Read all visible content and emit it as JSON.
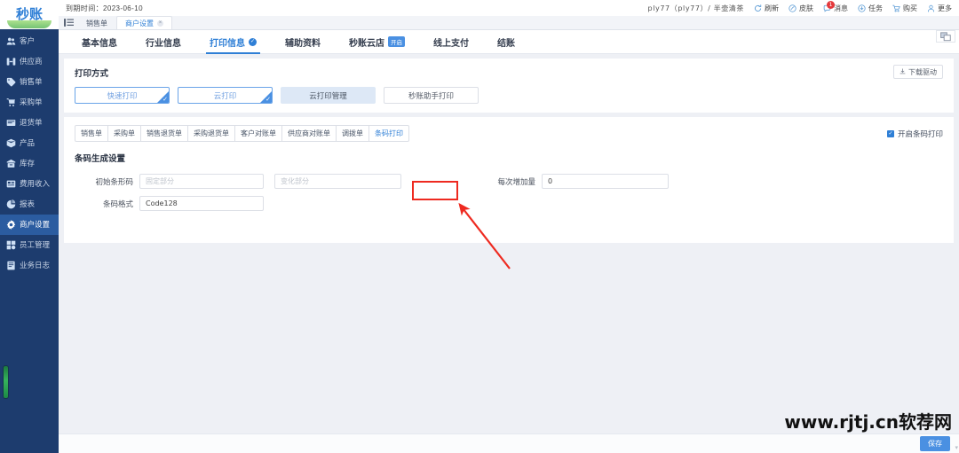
{
  "brand": {
    "logo_text": "秒账"
  },
  "sidebar": {
    "items": [
      {
        "label": "客户",
        "icon": "users-icon"
      },
      {
        "label": "供应商",
        "icon": "supplier-icon"
      },
      {
        "label": "销售单",
        "icon": "sales-order-icon"
      },
      {
        "label": "采购单",
        "icon": "cart-icon"
      },
      {
        "label": "退货单",
        "icon": "return-icon"
      },
      {
        "label": "产品",
        "icon": "box-icon"
      },
      {
        "label": "库存",
        "icon": "warehouse-icon"
      },
      {
        "label": "费用收入",
        "icon": "expense-icon"
      },
      {
        "label": "报表",
        "icon": "chart-icon"
      },
      {
        "label": "商户设置",
        "icon": "gear-icon"
      },
      {
        "label": "员工管理",
        "icon": "staff-icon"
      },
      {
        "label": "业务日志",
        "icon": "log-icon"
      }
    ],
    "active_index": 9
  },
  "topbar": {
    "expire_label": "到期时间：2023-06-10",
    "user": "ply77（ply77）/ 半壶清茶",
    "actions": [
      {
        "label": "刷新",
        "icon": "refresh-icon",
        "badge": ""
      },
      {
        "label": "皮肤",
        "icon": "skin-icon",
        "badge": ""
      },
      {
        "label": "消息",
        "icon": "message-icon",
        "badge": "1"
      },
      {
        "label": "任务",
        "icon": "task-icon",
        "badge": ""
      },
      {
        "label": "购买",
        "icon": "cart-icon",
        "badge": ""
      },
      {
        "label": "更多",
        "icon": "user-more-icon",
        "badge": ""
      }
    ]
  },
  "window_tabs": {
    "items": [
      {
        "label": "销售单",
        "closable": false,
        "active": false
      },
      {
        "label": "商户设置",
        "closable": true,
        "active": true
      }
    ],
    "close_glyph": "×"
  },
  "module_tabs": [
    {
      "label": "基本信息",
      "active": false,
      "badge": ""
    },
    {
      "label": "行业信息",
      "active": false,
      "badge": ""
    },
    {
      "label": "打印信息",
      "active": true,
      "badge": ""
    },
    {
      "label": "辅助资料",
      "active": false,
      "badge": ""
    },
    {
      "label": "秒账云店",
      "active": false,
      "badge": "开启"
    },
    {
      "label": "线上支付",
      "active": false,
      "badge": ""
    },
    {
      "label": "结账",
      "active": false,
      "badge": ""
    }
  ],
  "print_section": {
    "title": "打印方式",
    "download_label": "下载驱动",
    "buttons": [
      {
        "label": "快速打印",
        "state": "selected"
      },
      {
        "label": "云打印",
        "state": "selected"
      },
      {
        "label": "云打印管理",
        "state": "filled"
      },
      {
        "label": "秒账助手打印",
        "state": "normal"
      }
    ]
  },
  "doc_tabs": {
    "items": [
      {
        "label": "销售单",
        "active": false
      },
      {
        "label": "采购单",
        "active": false
      },
      {
        "label": "销售退货单",
        "active": false
      },
      {
        "label": "采购退货单",
        "active": false
      },
      {
        "label": "客户对账单",
        "active": false
      },
      {
        "label": "供应商对账单",
        "active": false
      },
      {
        "label": "调拨单",
        "active": false
      },
      {
        "label": "条码打印",
        "active": true
      }
    ],
    "checkbox": {
      "label": "开启条码打印",
      "checked": true,
      "glyph": "✓"
    }
  },
  "barcode_form": {
    "title": "条码生成设置",
    "fields": {
      "initial_label": "初始条形码",
      "fixed_placeholder": "固定部分",
      "variable_placeholder": "变化部分",
      "format_label": "条码格式",
      "format_value": "Code128",
      "increment_label": "每次增加量",
      "increment_value": "0"
    }
  },
  "footer": {
    "save_label": "保存"
  },
  "watermark": {
    "text": "www.rjtj.cn软荐网"
  },
  "colors": {
    "sidebar": "#1d3c6e",
    "sidebar_active": "#2b5ca0",
    "accent": "#2f7fd6",
    "button_blue": "#4a90e2",
    "annotation_red": "#ee2a20",
    "badge_red": "#e4393c",
    "page_bg": "#eef0f5"
  }
}
